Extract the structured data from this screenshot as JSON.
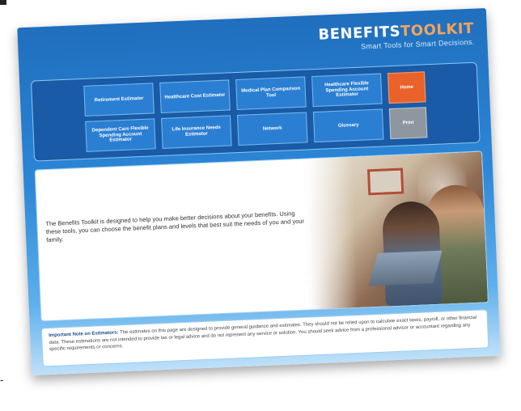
{
  "brand": {
    "name_main": "BENEFITS",
    "name_accent": "TOOLKIT",
    "tagline": "Smart Tools for Smart Decisions."
  },
  "nav": {
    "items": [
      {
        "label": "Retirement Estimator"
      },
      {
        "label": "Healthcare Cost Estimator"
      },
      {
        "label": "Medical Plan Comparison Tool"
      },
      {
        "label": "Healthcare Flexible Spending Account Estimator"
      },
      {
        "label": "Home"
      },
      {
        "label": "Dependent Care Flexible Spending Account Estimator"
      },
      {
        "label": "Life Insurance Needs Estimator"
      },
      {
        "label": "Network"
      },
      {
        "label": "Glossary"
      },
      {
        "label": "Print"
      }
    ]
  },
  "intro": {
    "text": "The Benefits Toolkit is designed to help you make better decisions about your benefits. Using these tools, you can choose the benefit plans and levels that best suit the needs of you and your family."
  },
  "note": {
    "heading": "Important Note on Estimators:",
    "body": "The estimates on this page are designed to provide general guidance and estimates. They should not be relied upon to calculate exact taxes, payroll, or other financial data. These estimations are not intended to provide tax or legal advice and do not represent any service or solution. You should seek advice from a professional advisor or accountant regarding any specific requirements or concerns."
  },
  "colors": {
    "accent": "#f6a35a",
    "home_button": "#e8622a",
    "print_button": "#8e979f",
    "nav_button": "#2b7fd2"
  }
}
